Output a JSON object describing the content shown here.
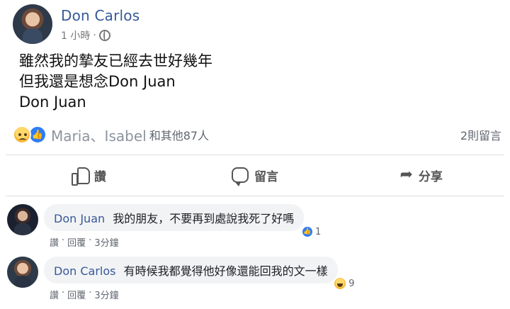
{
  "post": {
    "author": "Don Carlos",
    "time": "1 小時",
    "separator": "·",
    "lines": [
      "雖然我的摯友已經去世好幾年",
      "但我還是想念Don Juan",
      "Don Juan"
    ]
  },
  "reactions": {
    "names": "Maria、Isabel",
    "rest": "和其他87人",
    "comment_count": "2則留言"
  },
  "actions": {
    "like": "讚",
    "comment": "留言",
    "share": "分享"
  },
  "comments": [
    {
      "author": "Don Juan",
      "text": "我的朋友，不要再到處說我死了好嗎",
      "like": "讚",
      "reply": "回覆",
      "time": "3分鐘",
      "reaction_count": "1"
    },
    {
      "author": "Don Carlos",
      "text": "有時候我都覺得他好像還能回我的文一樣",
      "like": "讚",
      "reply": "回覆",
      "time": "3分鐘",
      "reaction_count": "9"
    }
  ],
  "colors": {
    "author_link": "#365899",
    "like_blue": "#2f7cf6",
    "bubble_bg": "#f2f3f5"
  }
}
